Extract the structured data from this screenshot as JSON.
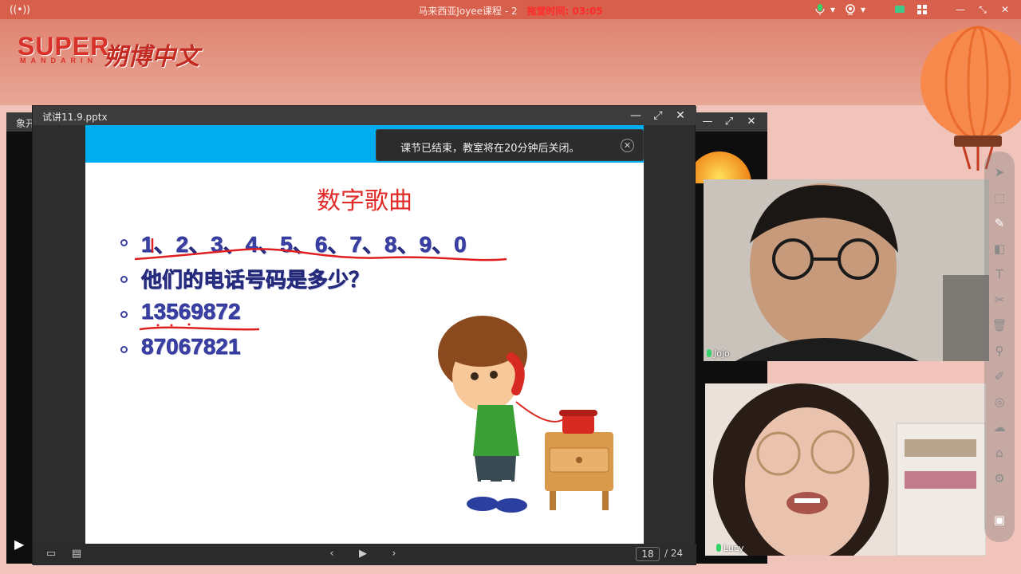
{
  "titlebar": {
    "title": "马来西亚Joyee课程 - 2",
    "timer_label": "拖堂时间: 03:05",
    "left_icon": "broadcast-icon",
    "icons": [
      "mic-icon",
      "camera-icon",
      "screen-icon",
      "grid-icon",
      "minimize-icon",
      "restore-icon",
      "close-icon"
    ]
  },
  "logo": {
    "super": "SUPER",
    "mandarin": "MANDARIN",
    "chinese": "朔博中文"
  },
  "background_window": {
    "title": "象开"
  },
  "ppt_window": {
    "title": "试讲11.9.pptx"
  },
  "toast": {
    "message": "课节已结束，教室将在20分钟后关闭。"
  },
  "slide": {
    "title": "数字歌曲",
    "bullets": [
      "1、2、3、4、5、6、7、8、9、0",
      "他们的电话号码是多少？",
      "13569872",
      "87067821"
    ],
    "annotation_color": "#e02020"
  },
  "pager": {
    "current": "18",
    "separator": "/",
    "total": "24"
  },
  "videos": {
    "student_name": "Jojo",
    "teacher_name": "Lucy"
  },
  "colors": {
    "app_titlebar": "#d6604c",
    "slide_band": "#00aeef",
    "slide_title": "#e02a28",
    "bullet_text": "#3a40a8"
  }
}
